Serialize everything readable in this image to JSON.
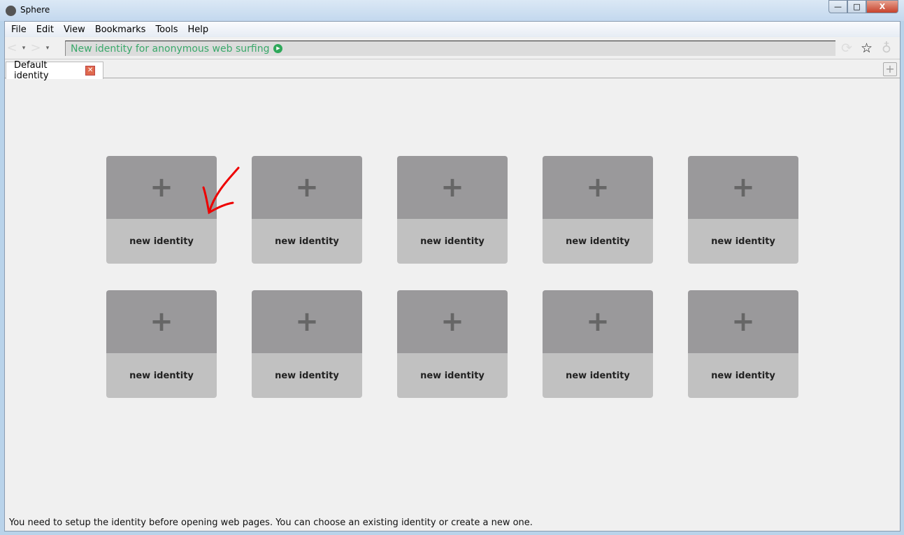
{
  "window": {
    "title": "Sphere",
    "minimize": "—",
    "maximize": "□",
    "close": "X"
  },
  "menu": [
    "File",
    "Edit",
    "View",
    "Bookmarks",
    "Tools",
    "Help"
  ],
  "navbar": {
    "back": "<",
    "forward": ">",
    "dropdown": "▾",
    "url_text": "New identity for anonymous web surfing",
    "go": "▶",
    "reload": "⟳",
    "star": "☆",
    "onion": "♁"
  },
  "tabs": [
    {
      "label": "Default identity",
      "close": "✕"
    }
  ],
  "new_tab": "+",
  "cards": [
    {
      "plus": "+",
      "label": "new identity"
    },
    {
      "plus": "+",
      "label": "new identity"
    },
    {
      "plus": "+",
      "label": "new identity"
    },
    {
      "plus": "+",
      "label": "new identity"
    },
    {
      "plus": "+",
      "label": "new identity"
    },
    {
      "plus": "+",
      "label": "new identity"
    },
    {
      "plus": "+",
      "label": "new identity"
    },
    {
      "plus": "+",
      "label": "new identity"
    },
    {
      "plus": "+",
      "label": "new identity"
    },
    {
      "plus": "+",
      "label": "new identity"
    }
  ],
  "status": "You need to setup the identity before opening web pages. You can choose an existing identity or create a new one."
}
